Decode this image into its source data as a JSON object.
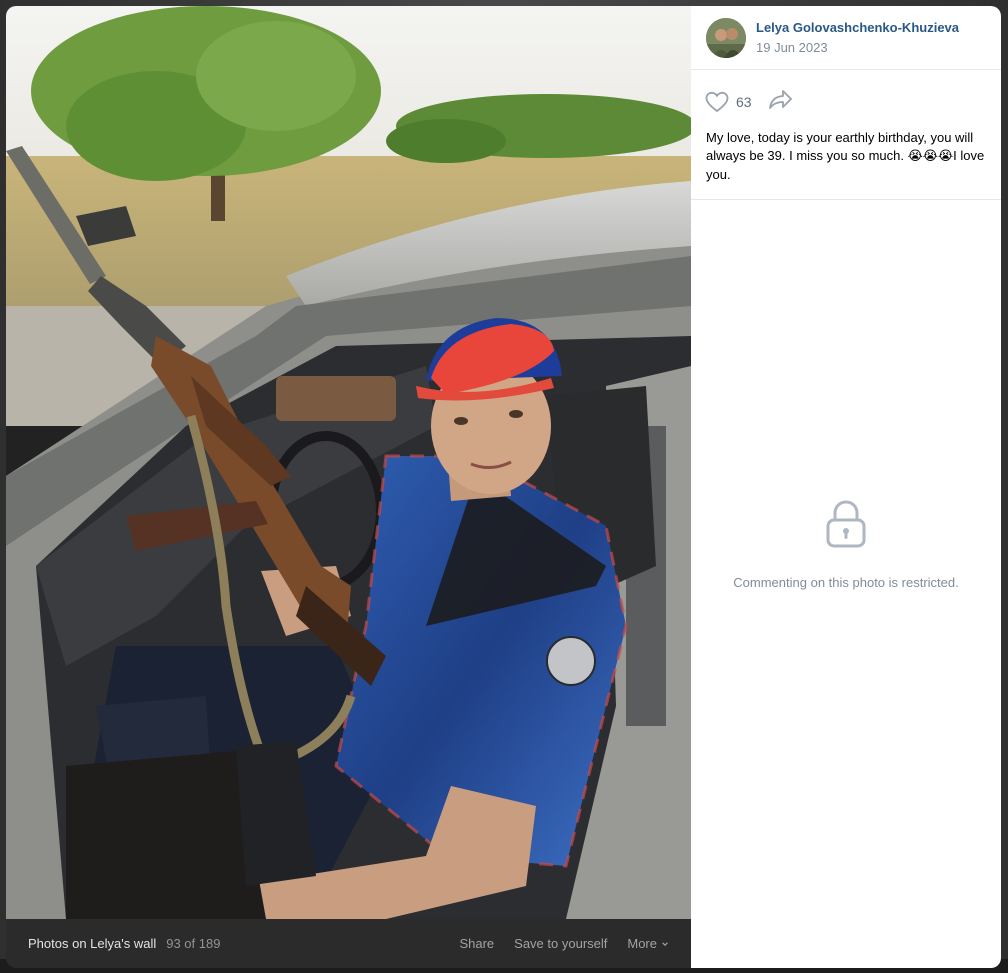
{
  "author": {
    "name": "Lelya Golovashchenko-Khuzieva",
    "date": "19 Jun 2023"
  },
  "actions": {
    "like_count": "63"
  },
  "caption": {
    "text": "My love, today is your earthly birthday, you will always be 39. I miss you so much. ",
    "emoji": "😭😭😭",
    "tail": "I love you."
  },
  "comments": {
    "restricted_text": "Commenting on this photo is restricted."
  },
  "footer": {
    "album": "Photos on Lelya's wall",
    "counter": "93 of 189",
    "share": "Share",
    "save": "Save to yourself",
    "more": "More"
  },
  "icons": {
    "like": "heart-icon",
    "share": "share-arrow-icon",
    "lock": "lock-icon",
    "more": "chevron-down-icon"
  },
  "colors": {
    "link": "#2a5885",
    "secondary": "#818c99",
    "footer_bg": "#2b2b2b"
  }
}
